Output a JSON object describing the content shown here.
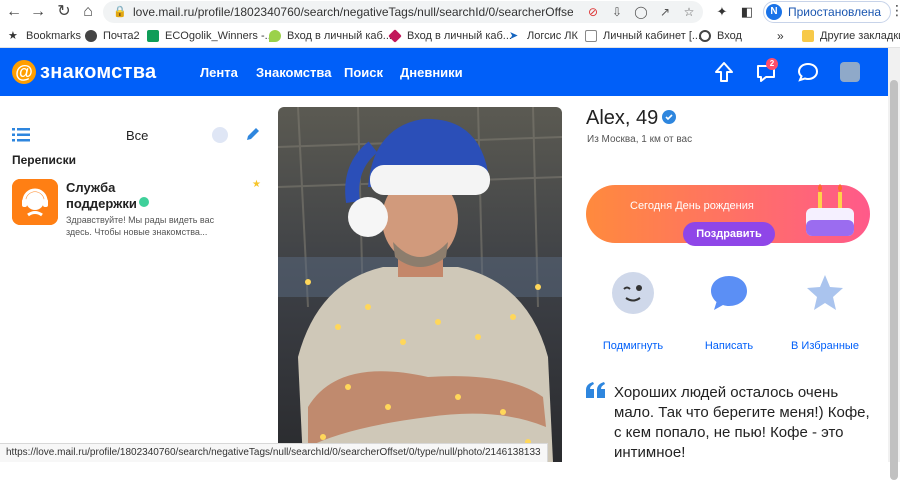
{
  "browser": {
    "url": "love.mail.ru/profile/1802340760/search/negativeTags/null/searchId/0/searcherOffset/0/ty...",
    "profile_avatar_letter": "N",
    "profile_status": "Приостановлена",
    "bookmarks": [
      {
        "label": "Bookmarks",
        "icon": "star-icon"
      },
      {
        "label": "Почта2",
        "icon": "globe-icon"
      },
      {
        "label": "ECOgolik_Winners -...",
        "icon": "sheets-icon"
      },
      {
        "label": "Вход в личный каб...",
        "icon": "pin-icon"
      },
      {
        "label": "Вход в личный каб...",
        "icon": "diamond-icon"
      },
      {
        "label": "Логсис ЛК",
        "icon": "arrow-icon"
      },
      {
        "label": "Личный кабинет [...",
        "icon": "page-icon"
      },
      {
        "label": "Вход",
        "icon": "search-icon"
      }
    ],
    "other_bookmarks": "Другие закладки",
    "status_url": "https://love.mail.ru/profile/1802340760/search/negativeTags/null/searchId/0/searcherOffset/0/type/null/photo/2146138133"
  },
  "header": {
    "logo_text": "знакомства",
    "nav": [
      "Лента",
      "Знакомства",
      "Поиск",
      "Дневники"
    ],
    "notif_count": "2",
    "brand_color": "#005ff9"
  },
  "sidebar": {
    "filter": "Все",
    "section_title": "Переписки",
    "chat": {
      "name": "Служба поддержки",
      "preview": "Здравствуйте! Мы рады видеть вас здесь. Чтобы новые знакомства..."
    }
  },
  "profile": {
    "name": "Alex, 49",
    "location": "Из Москва, 1 км от вас",
    "birthday_text": "Сегодня День рождения",
    "congratulate_label": "Поздравить",
    "actions": [
      {
        "label": "Подмигнуть",
        "icon": "wink-icon"
      },
      {
        "label": "Написать",
        "icon": "message-icon"
      },
      {
        "label": "В Избранные",
        "icon": "star-icon"
      }
    ],
    "about": "Хороших людей осталось очень мало. Так что берегите меня!) Кофе, с кем попало, не пью! Кофе - это интимное!"
  }
}
